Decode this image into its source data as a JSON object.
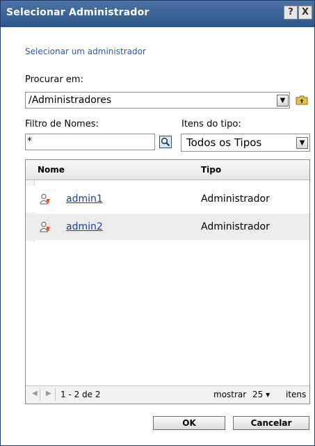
{
  "window": {
    "title": "Selecionar Administrador",
    "help_label": "?",
    "close_label": "X"
  },
  "subtitle": "Selecionar um administrador",
  "browse": {
    "label": "Procurar em:",
    "path_value": "/Administradores"
  },
  "filter": {
    "label": "Filtro de Nomes:",
    "value": "*"
  },
  "type_filter": {
    "label": "Itens do tipo:",
    "selected": "Todos os Tipos"
  },
  "table": {
    "headers": {
      "name": "Nome",
      "type": "Tipo"
    },
    "rows": [
      {
        "name": "admin1",
        "type": "Administrador"
      },
      {
        "name": "admin2",
        "type": "Administrador"
      }
    ],
    "footer": {
      "range": "1 - 2 de 2",
      "show_label": "mostrar",
      "page_size": "25",
      "items_label": "itens"
    }
  },
  "buttons": {
    "ok": "OK",
    "cancel": "Cancelar"
  },
  "colors": {
    "titlebar": "#3b6194",
    "link": "#1d3f9a",
    "subtitle": "#2c5aa0",
    "row_alt": "#ececec",
    "selected_row_strip": "#f4f4f4"
  }
}
